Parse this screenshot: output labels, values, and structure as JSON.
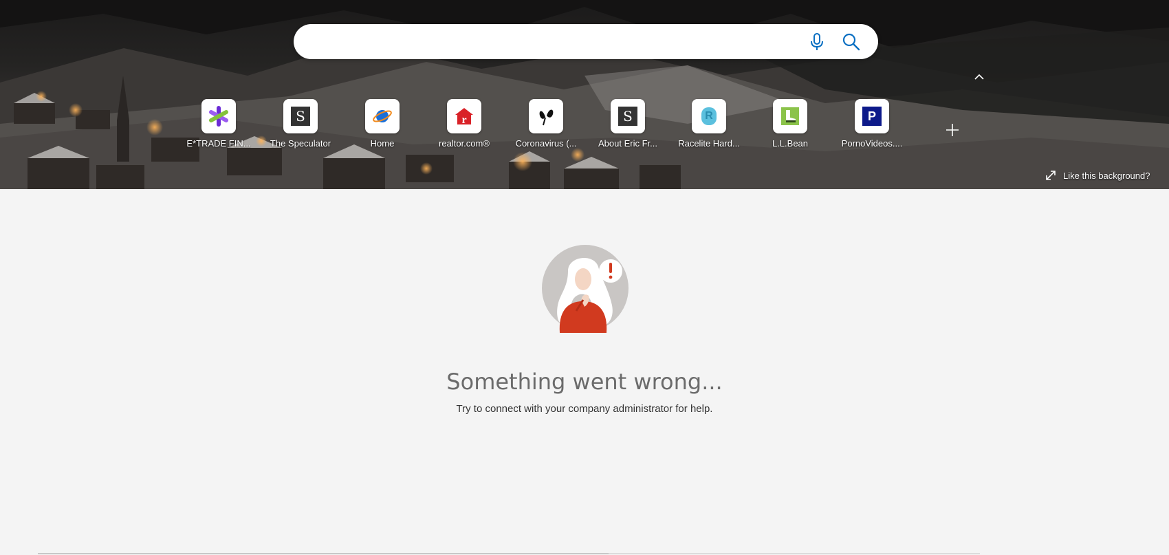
{
  "search": {
    "value": "",
    "placeholder": "",
    "mic_icon": "microphone-icon",
    "search_icon": "search-icon"
  },
  "quick_links": [
    {
      "label": "E*TRADE FIN...",
      "icon": "etrade-icon"
    },
    {
      "label": "The Speculator",
      "icon": "letter-s-icon",
      "glyph": "S"
    },
    {
      "label": "Home",
      "icon": "planet-icon"
    },
    {
      "label": "realtor.com®",
      "icon": "realtor-icon",
      "glyph": "r"
    },
    {
      "label": "Coronavirus (...",
      "icon": "butterfly-icon"
    },
    {
      "label": "About Eric Fr...",
      "icon": "letter-s-icon",
      "glyph": "S"
    },
    {
      "label": "Racelite Hard...",
      "icon": "racelite-icon",
      "glyph": "R"
    },
    {
      "label": "L.L.Bean",
      "icon": "boot-icon"
    },
    {
      "label": "PornoVideos....",
      "icon": "letter-p-icon",
      "glyph": "P"
    }
  ],
  "background_link": "Like this background?",
  "error": {
    "title": "Something went wrong...",
    "subtitle": "Try to connect with your company administrator for help."
  },
  "colors": {
    "search_icon": "#0a6fc2",
    "error_title": "#6b6b6b",
    "page_bg": "#f4f4f4",
    "alert_red": "#d13a1f"
  }
}
